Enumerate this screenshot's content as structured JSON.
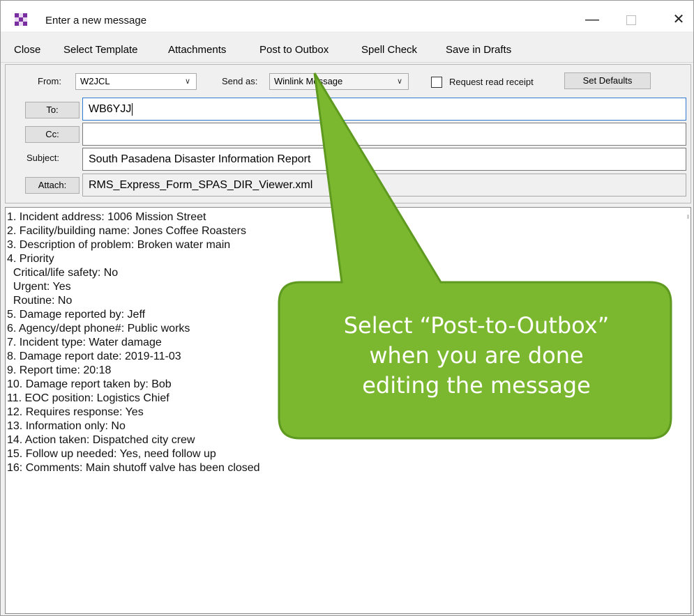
{
  "window": {
    "title": "Enter a new message",
    "controls": {
      "minimize": "—",
      "close": "✕"
    }
  },
  "menu": [
    "Close",
    "Select Template",
    "Attachments",
    "Post to Outbox",
    "Spell Check",
    "Save in Drafts"
  ],
  "header": {
    "from_label": "From:",
    "from_value": "W2JCL",
    "send_as_label": "Send as:",
    "send_as_value": "Winlink Message",
    "request_read_receipt_label": "Request read receipt",
    "request_read_receipt_checked": false,
    "set_defaults_label": "Set Defaults",
    "to_button": "To:",
    "to_value": "WB6YJJ",
    "cc_button": "Cc:",
    "cc_value": "",
    "subject_label": "Subject:",
    "subject_value": "South Pasadena Disaster Information Report",
    "attach_button": "Attach:",
    "attach_value": "RMS_Express_Form_SPAS_DIR_Viewer.xml"
  },
  "body": {
    "lines": [
      "1. Incident address: 1006 Mission Street",
      "2. Facility/building name: Jones Coffee Roasters",
      "3. Description of problem: Broken water main",
      "4. Priority",
      "  Critical/life safety: No",
      "  Urgent: Yes",
      "  Routine: No",
      "5. Damage reported by: Jeff",
      "6. Agency/dept phone#: Public works",
      "7. Incident type: Water damage",
      "8. Damage report date: 2019-11-03",
      "9. Report time: 20:18",
      "10. Damage report taken by: Bob",
      "11. EOC position: Logistics Chief",
      "12. Requires response: Yes",
      "13. Information only: No",
      "14. Action taken: Dispatched city crew",
      "15. Follow up needed: Yes, need follow up",
      "16: Comments: Main shutoff valve has been closed"
    ]
  },
  "callout": {
    "line1": "Select “Post-to-Outbox”",
    "line2": "when you are done",
    "line3": "editing the message",
    "fill_color": "#7cb82f",
    "border_color": "#5e9a1f"
  }
}
